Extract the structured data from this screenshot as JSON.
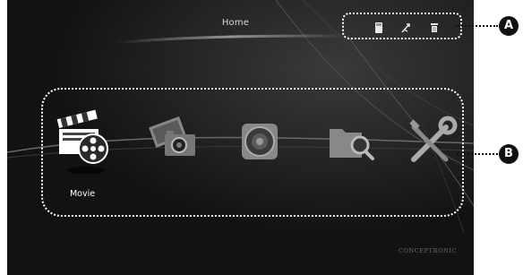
{
  "header": {
    "title": "Home",
    "icons": [
      "memory-card-icon",
      "usb-icon",
      "trash-icon"
    ]
  },
  "menu": {
    "items": [
      {
        "name": "movie-icon",
        "label": "Movie",
        "selected": true
      },
      {
        "name": "photo-icon",
        "label": "",
        "selected": false
      },
      {
        "name": "music-icon",
        "label": "",
        "selected": false
      },
      {
        "name": "file-browser-icon",
        "label": "",
        "selected": false
      },
      {
        "name": "settings-icon",
        "label": "",
        "selected": false
      }
    ]
  },
  "brand": "CONCEPTRONIC",
  "callouts": {
    "a": "A",
    "b": "B"
  },
  "colors": {
    "background": "#121212",
    "text": "#d8d8d8",
    "highlight": "#ffffff"
  }
}
